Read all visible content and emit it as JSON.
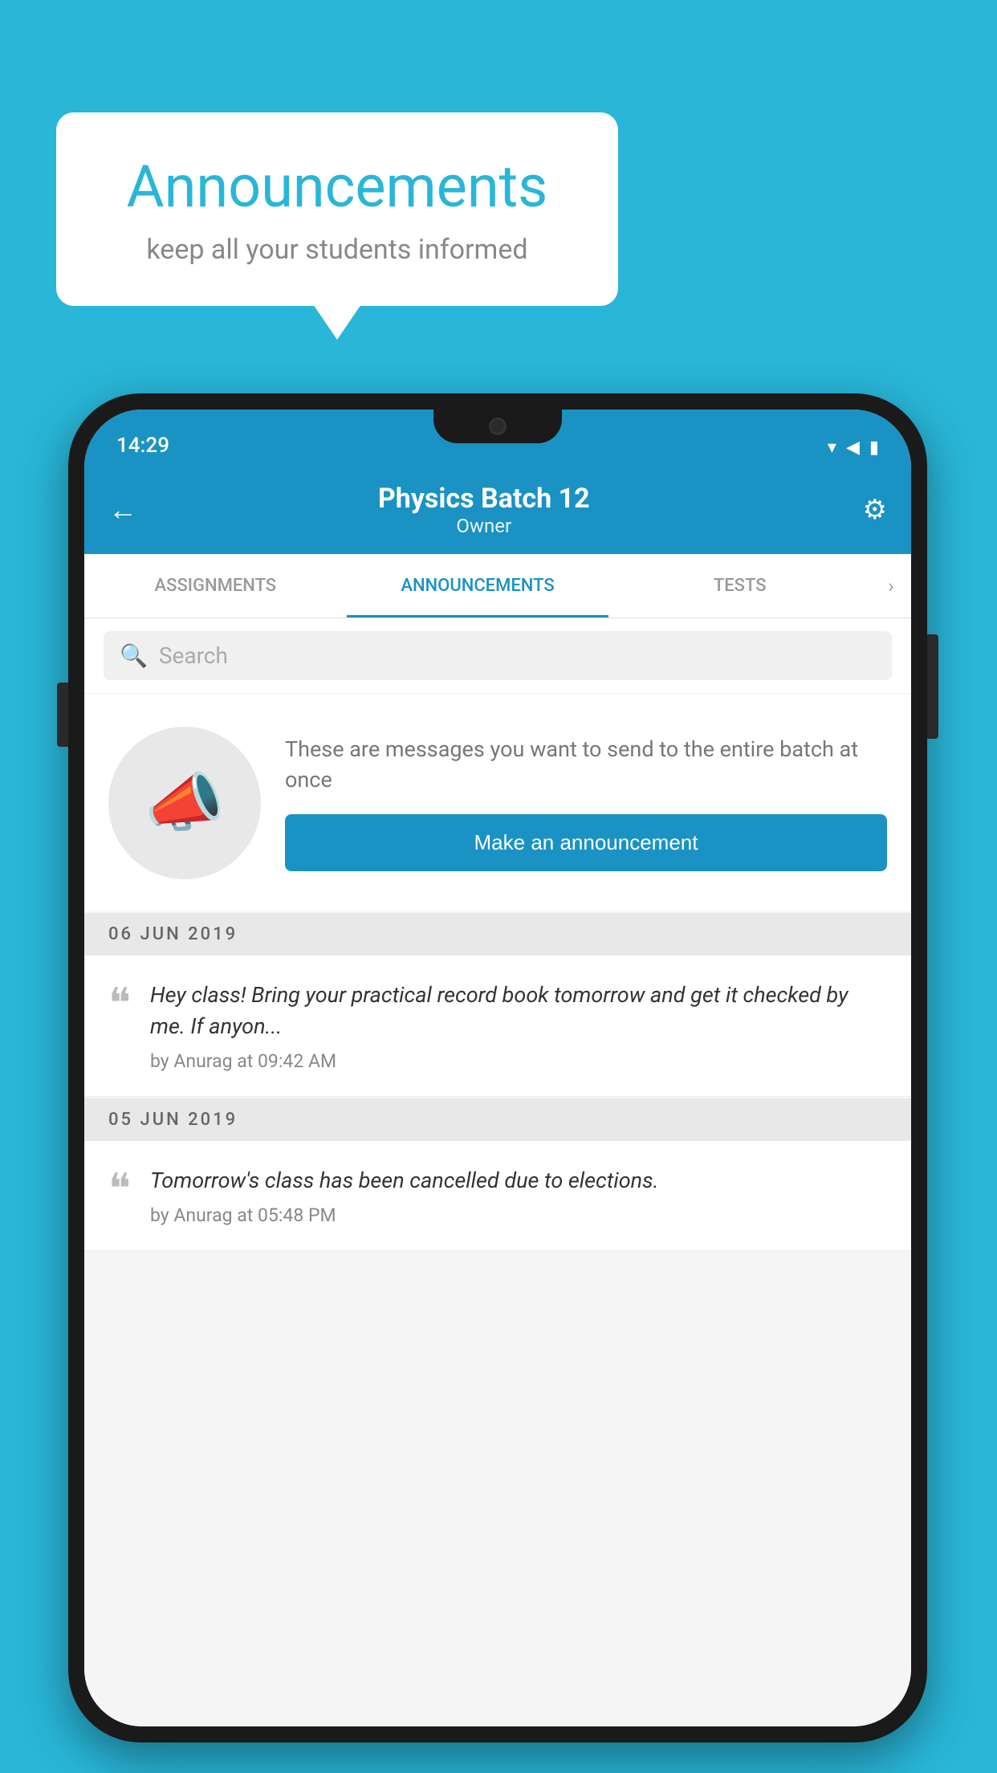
{
  "background_color": "#29b6d8",
  "speech_bubble": {
    "title": "Announcements",
    "subtitle": "keep all your students informed"
  },
  "status_bar": {
    "time": "14:29",
    "wifi": "▾",
    "signal": "▲",
    "battery": "▮"
  },
  "app_bar": {
    "title": "Physics Batch 12",
    "subtitle": "Owner",
    "back_label": "←",
    "settings_label": "⚙"
  },
  "tabs": [
    {
      "label": "ASSIGNMENTS",
      "active": false
    },
    {
      "label": "ANNOUNCEMENTS",
      "active": true
    },
    {
      "label": "TESTS",
      "active": false
    }
  ],
  "search": {
    "placeholder": "Search"
  },
  "promo": {
    "description": "These are messages you want to send to the entire batch at once",
    "button_label": "Make an announcement"
  },
  "date_sections": [
    {
      "date": "06  JUN  2019",
      "announcements": [
        {
          "text": "Hey class! Bring your practical record book tomorrow and get it checked by me. If anyon...",
          "meta": "by Anurag at 09:42 AM"
        }
      ]
    },
    {
      "date": "05  JUN  2019",
      "announcements": [
        {
          "text": "Tomorrow's class has been cancelled due to elections.",
          "meta": "by Anurag at 05:48 PM"
        }
      ]
    }
  ]
}
